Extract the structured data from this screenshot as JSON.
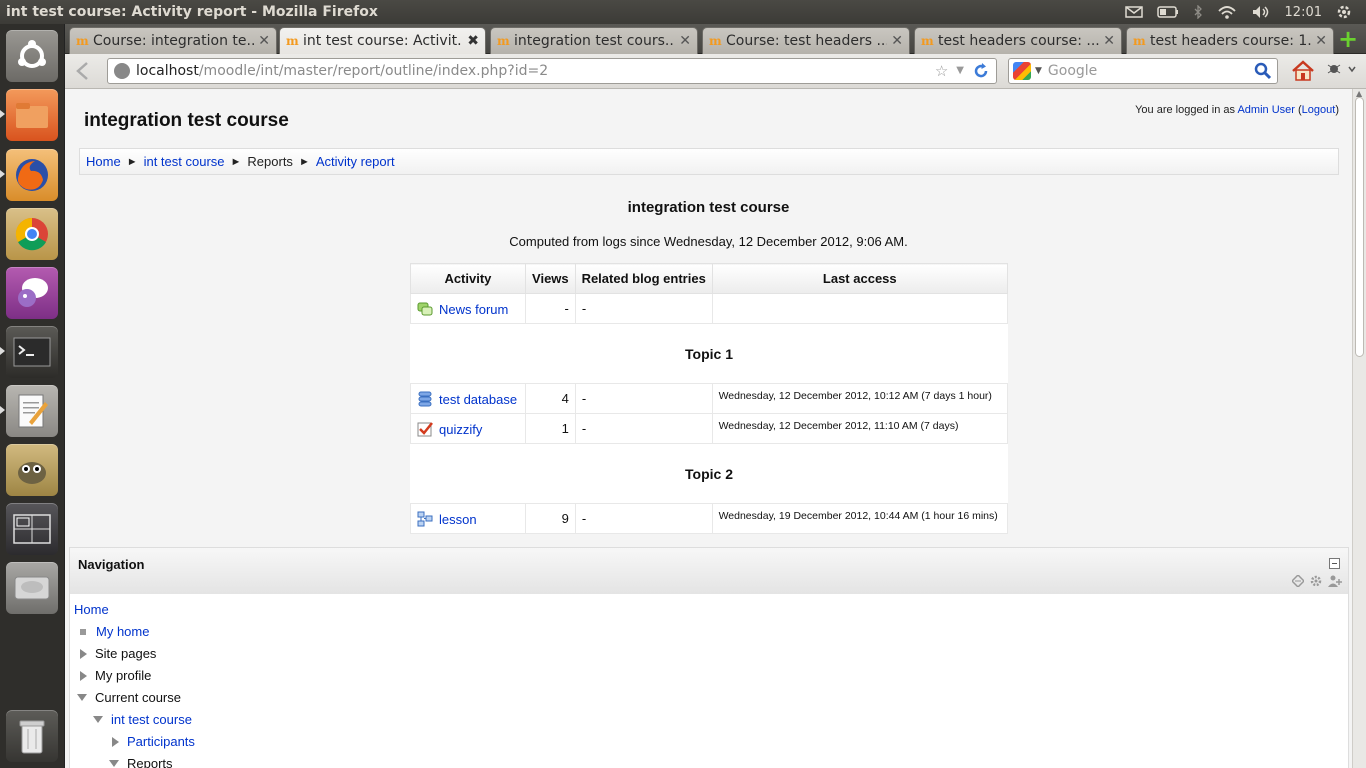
{
  "window": {
    "title": "int test course: Activity report - Mozilla Firefox"
  },
  "tray": {
    "time": "12:01"
  },
  "tabs": [
    {
      "title": "Course: integration te...",
      "active": false
    },
    {
      "title": "int test course: Activit...",
      "active": true
    },
    {
      "title": "integration test cours...",
      "active": false
    },
    {
      "title": "Course: test headers ...",
      "active": false
    },
    {
      "title": "test headers course: ...",
      "active": false
    },
    {
      "title": "test headers course: 1...",
      "active": false
    }
  ],
  "url": {
    "host": "localhost",
    "path": "/moodle/int/master/report/outline/index.php?id=2"
  },
  "search": {
    "placeholder": "Google"
  },
  "page": {
    "course_title": "integration test course",
    "login_prefix": "You are logged in as ",
    "login_user": "Admin User",
    "login_logout": "Logout",
    "breadcrumb": [
      "Home",
      "int test course",
      "Reports",
      "Activity report"
    ],
    "heading": "integration test course",
    "computed": "Computed from logs since Wednesday, 12 December 2012, 9:06 AM."
  },
  "report": {
    "headers": [
      "Activity",
      "Views",
      "Related blog entries",
      "Last access"
    ],
    "rows": {
      "news": {
        "name": "News forum",
        "views": "-",
        "blog": "-",
        "last": ""
      },
      "topic1": "Topic 1",
      "database": {
        "name": "test database",
        "views": "4",
        "blog": "-",
        "last": "Wednesday, 12 December 2012, 10:12 AM (7 days 1 hour)"
      },
      "quiz": {
        "name": "quizzify",
        "views": "1",
        "blog": "-",
        "last": "Wednesday, 12 December 2012, 11:10 AM (7 days)"
      },
      "topic2": "Topic 2",
      "lesson": {
        "name": "lesson",
        "views": "9",
        "blog": "-",
        "last": "Wednesday, 19 December 2012, 10:44 AM (1 hour 16 mins)"
      }
    }
  },
  "navigation": {
    "title": "Navigation",
    "home": "Home",
    "my_home": "My home",
    "site_pages": "Site pages",
    "my_profile": "My profile",
    "current_course": "Current course",
    "course": "int test course",
    "participants": "Participants",
    "reports": "Reports"
  }
}
